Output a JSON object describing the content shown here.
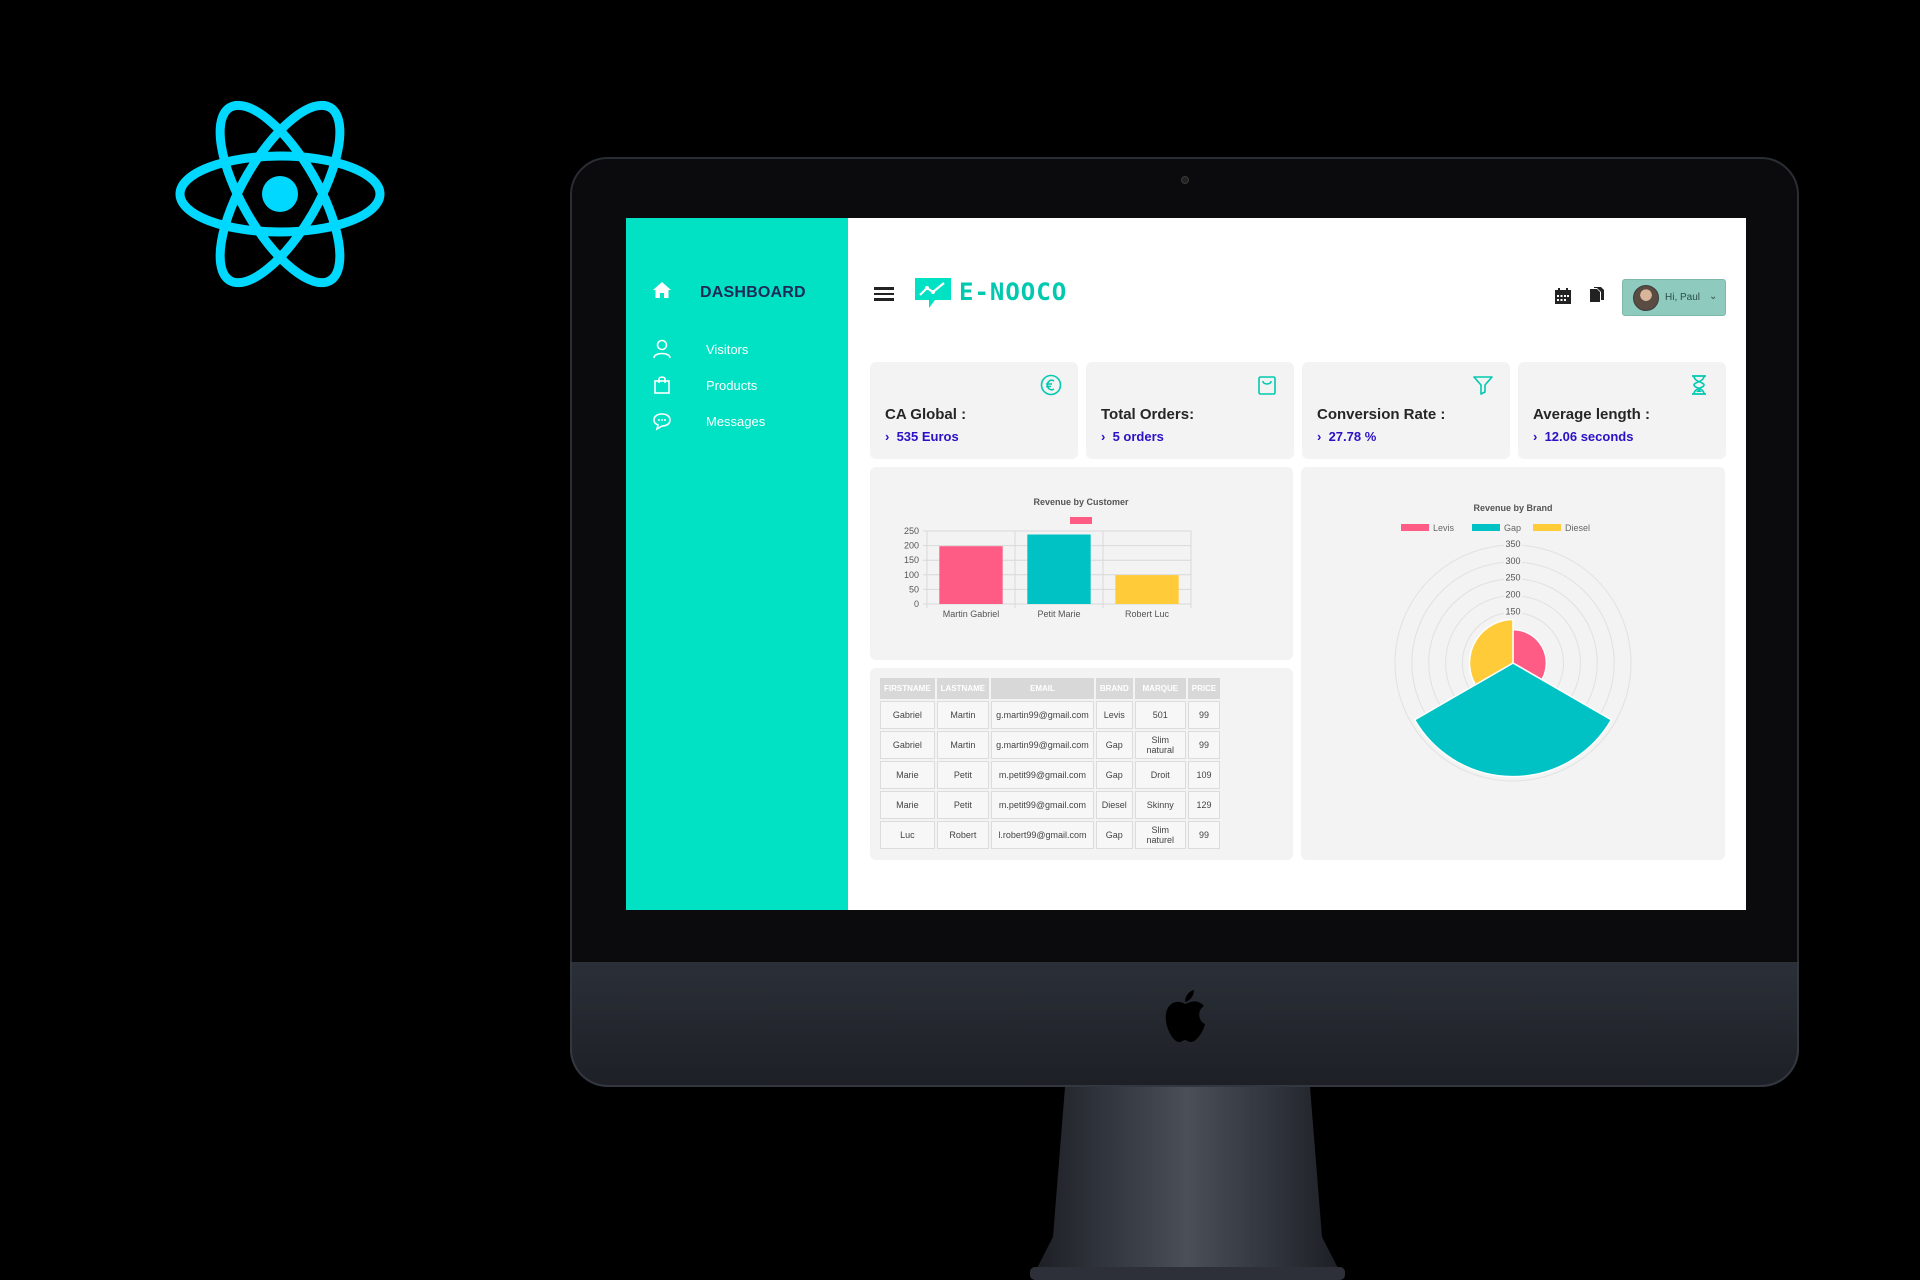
{
  "sidebar": {
    "title": "DASHBOARD",
    "items": [
      {
        "label": "Visitors",
        "icon": "user-icon"
      },
      {
        "label": "Products",
        "icon": "bag-icon"
      },
      {
        "label": "Messages",
        "icon": "chat-icon"
      }
    ],
    "color": "#01e1c4"
  },
  "header": {
    "brand": "E-NOOCO",
    "user_label": "Hi, Paul",
    "brand_color": "#01c9b0"
  },
  "stats": [
    {
      "title": "CA Global :",
      "value": "535 Euros",
      "icon": "euro-icon"
    },
    {
      "title": "Total Orders:",
      "value": "5 orders",
      "icon": "shopping-bag-icon"
    },
    {
      "title": "Conversion Rate :",
      "value": "27.78 %",
      "icon": "funnel-icon"
    },
    {
      "title": "Average length :",
      "value": "12.06 seconds",
      "icon": "hourglass-icon"
    }
  ],
  "chart_data": [
    {
      "type": "bar",
      "title": "Revenue by Customer",
      "categories": [
        "Martin Gabriel",
        "Petit Marie",
        "Robert Luc"
      ],
      "values": [
        198,
        238,
        99
      ],
      "colors": [
        "#ff5c85",
        "#00c2c4",
        "#ffcb38"
      ],
      "ylim": [
        0,
        250
      ],
      "yticks": [
        "250",
        "200",
        "150",
        "100",
        "50",
        "0"
      ],
      "grid": true,
      "legend_swatch_color": "#ff5c85"
    },
    {
      "type": "polar",
      "title": "Revenue by Brand",
      "categories": [
        "Levis",
        "Gap",
        "Diesel"
      ],
      "values": [
        99,
        337,
        129
      ],
      "colors": [
        "#ff5c85",
        "#00c2c4",
        "#ffcb38"
      ],
      "rlim": [
        0,
        350
      ],
      "rticks": [
        "350",
        "300",
        "250",
        "200",
        "150"
      ],
      "legend": "top"
    }
  ],
  "table": {
    "columns": [
      "FIRSTNAME",
      "LASTNAME",
      "EMAIL",
      "BRAND",
      "MARQUE",
      "PRICE"
    ],
    "rows": [
      [
        "Gabriel",
        "Martin",
        "g.martin99@gmail.com",
        "Levis",
        "501",
        "99"
      ],
      [
        "Gabriel",
        "Martin",
        "g.martin99@gmail.com",
        "Gap",
        "Slim natural",
        "99"
      ],
      [
        "Marie",
        "Petit",
        "m.petit99@gmail.com",
        "Gap",
        "Droit",
        "109"
      ],
      [
        "Marie",
        "Petit",
        "m.petit99@gmail.com",
        "Diesel",
        "Skinny",
        "129"
      ],
      [
        "Luc",
        "Robert",
        "l.robert99@gmail.com",
        "Gap",
        "Slim naturel",
        "99"
      ]
    ]
  },
  "colors": {
    "accent_value": "#2a10c6",
    "react_blue": "#00d8ff"
  }
}
